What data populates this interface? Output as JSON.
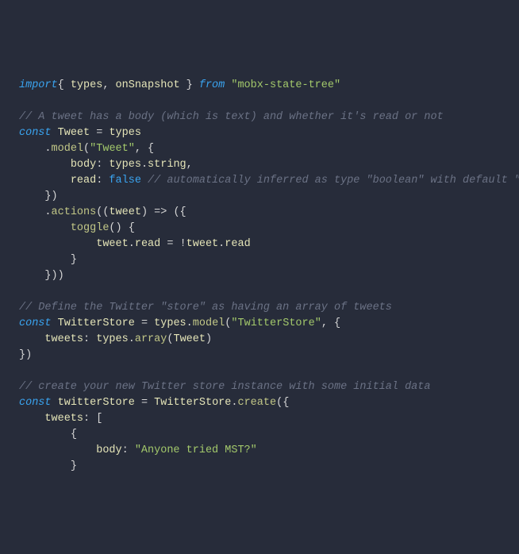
{
  "line1": {
    "kw1": "import",
    "brace1": "{ ",
    "id1": "types",
    "comma": ", ",
    "id2": "onSnapshot",
    "brace2": " }",
    "kw2": " from ",
    "str": "\"mobx-state-tree\""
  },
  "line2": "",
  "line3": {
    "cm": "// A tweet has a body (which is text) and whether it's read or not"
  },
  "line4": {
    "kw": "const",
    "sp": " ",
    "id1": "Tweet",
    "eq": " = ",
    "id2": "types"
  },
  "line5": {
    "indent": "    ",
    "dot": ".",
    "fn": "model",
    "open": "(",
    "str": "\"Tweet\"",
    "rest": ", {"
  },
  "line6": {
    "indent": "        ",
    "key": "body",
    "colon": ": ",
    "val1": "types",
    "dot": ".",
    "val2": "string",
    "comma": ","
  },
  "line7": {
    "indent": "        ",
    "key": "read",
    "colon": ": ",
    "val": "false",
    "sp": " ",
    "cm": "// automatically inferred as type \"boolean\" with default \"false\""
  },
  "line8": {
    "indent": "    ",
    "txt": "})"
  },
  "line9": {
    "indent": "    ",
    "dot": ".",
    "fn": "actions",
    "rest": "((",
    "id": "tweet",
    "rest2": ") => ({"
  },
  "line10": {
    "indent": "        ",
    "fn": "toggle",
    "rest": "() {"
  },
  "line11": {
    "indent": "            ",
    "a": "tweet",
    "b": ".",
    "c": "read",
    "d": " = !",
    "e": "tweet",
    "f": ".",
    "g": "read"
  },
  "line12": {
    "indent": "        ",
    "txt": "}"
  },
  "line13": {
    "indent": "    ",
    "txt": "}))"
  },
  "line14": "",
  "line15": {
    "cm": "// Define the Twitter \"store\" as having an array of tweets"
  },
  "line16": {
    "kw": "const",
    "sp": " ",
    "id1": "TwitterStore",
    "eq": " = ",
    "id2": "types",
    "dot": ".",
    "fn": "model",
    "open": "(",
    "str": "\"TwitterStore\"",
    "rest": ", {"
  },
  "line17": {
    "indent": "    ",
    "key": "tweets",
    "colon": ": ",
    "a": "types",
    "b": ".",
    "fn": "array",
    "c": "(",
    "d": "Tweet",
    "e": ")"
  },
  "line18": {
    "txt": "})"
  },
  "line19": "",
  "line20": {
    "cm": "// create your new Twitter store instance with some initial data"
  },
  "line21": {
    "kw": "const",
    "sp": " ",
    "id1": "twitterStore",
    "eq": " = ",
    "id2": "TwitterStore",
    "dot": ".",
    "fn": "create",
    "rest": "({"
  },
  "line22": {
    "indent": "    ",
    "key": "tweets",
    "rest": ": ["
  },
  "line23": {
    "indent": "        ",
    "txt": "{"
  },
  "line24": {
    "indent": "            ",
    "key": "body",
    "colon": ": ",
    "str": "\"Anyone tried MST?\""
  },
  "line25": {
    "indent": "        ",
    "txt": "}"
  }
}
